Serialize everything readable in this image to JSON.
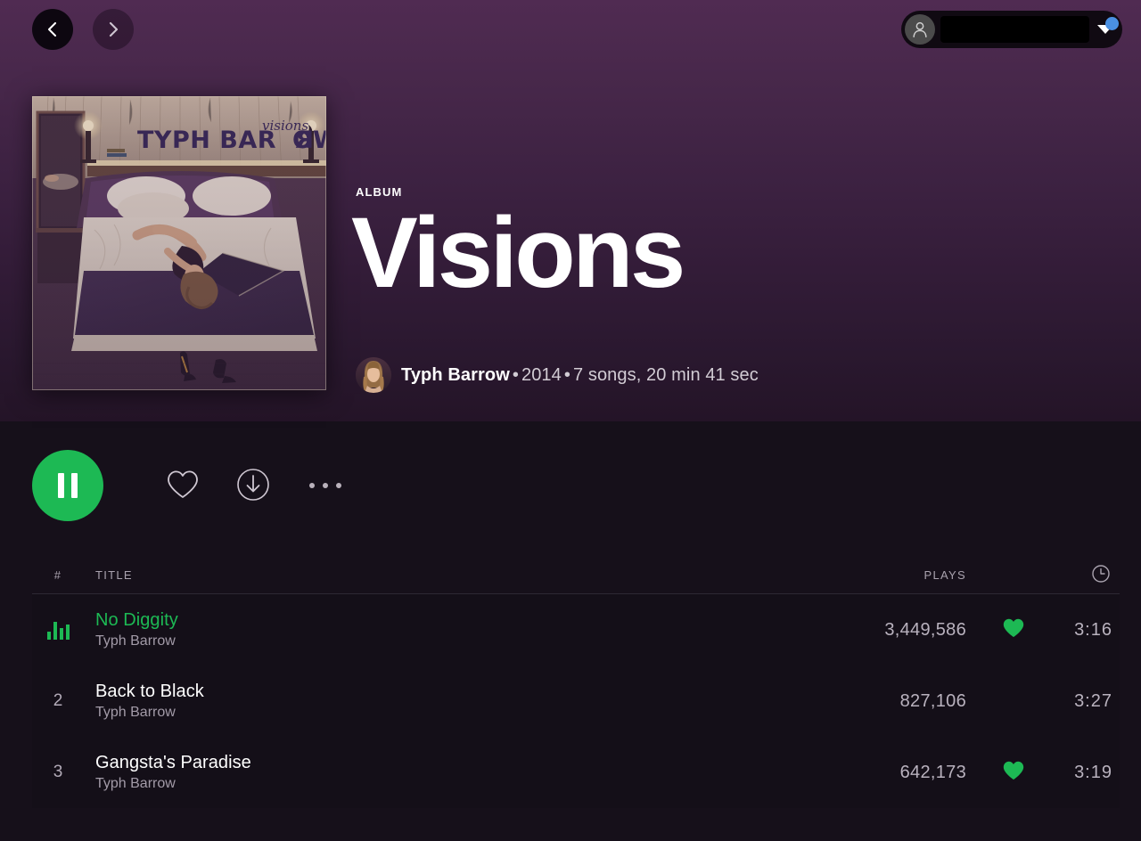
{
  "topbar": {
    "back_icon": "chevron-left-icon",
    "forward_icon": "chevron-right-icon",
    "user": {
      "name": "",
      "avatar_icon": "person-icon",
      "caret_icon": "caret-down-icon",
      "notification_dot_color": "#4a90e2"
    }
  },
  "album": {
    "kind_label": "ALBUM",
    "title": "Visions",
    "cover_alt": "Visions album cover — bedroom scene",
    "cover_text_main": "TYPH BARROW",
    "cover_text_script": "visions",
    "artist": "Typh Barrow",
    "year": "2014",
    "stats": "7 songs, 20 min 41 sec",
    "separator": "•"
  },
  "actions": {
    "play_state": "playing",
    "play_icon": "pause-icon",
    "like_icon": "heart-outline-icon",
    "download_icon": "download-circle-icon",
    "more_icon": "more-options-icon",
    "accent_color": "#1db954"
  },
  "tracklist": {
    "headers": {
      "number": "#",
      "title": "TITLE",
      "plays": "PLAYS",
      "duration_icon": "clock-icon"
    },
    "tracks": [
      {
        "number": "1",
        "number_display": "",
        "is_playing": true,
        "now_playing_icon": "equalizer-icon",
        "title": "No Diggity",
        "artist": "Typh Barrow",
        "plays": "3,449,586",
        "liked": true,
        "liked_icon": "heart-filled-icon",
        "duration": "3:16"
      },
      {
        "number": "2",
        "number_display": "2",
        "is_playing": false,
        "now_playing_icon": "",
        "title": "Back to Black",
        "artist": "Typh Barrow",
        "plays": "827,106",
        "liked": false,
        "liked_icon": "",
        "duration": "3:27"
      },
      {
        "number": "3",
        "number_display": "3",
        "is_playing": false,
        "now_playing_icon": "",
        "title": "Gangsta's Paradise",
        "artist": "Typh Barrow",
        "plays": "642,173",
        "liked": true,
        "liked_icon": "heart-filled-icon",
        "duration": "3:19"
      }
    ]
  },
  "theme": {
    "header_gradient_top": "#502b52",
    "header_gradient_bottom": "#241427",
    "body_background": "#16101a",
    "accent_green": "#1db954",
    "text_primary": "#ffffff",
    "text_secondary": "#a39ba8"
  }
}
